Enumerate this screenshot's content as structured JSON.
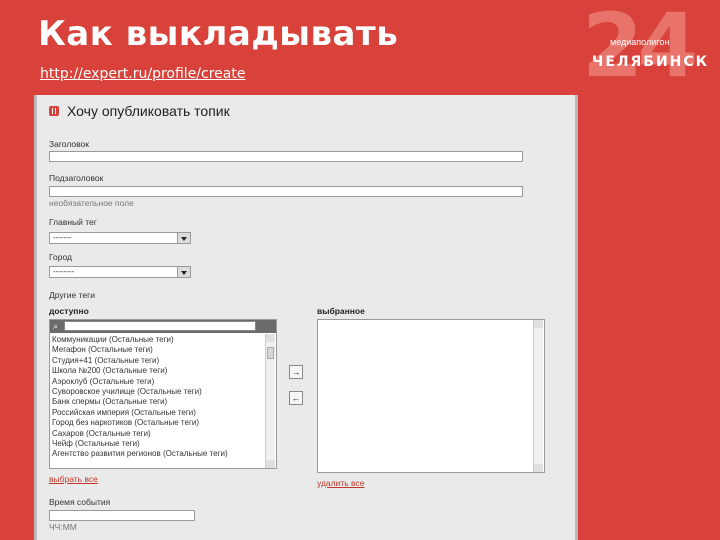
{
  "slide": {
    "title": "Как выкладывать",
    "url": "http://expert.ru/profile/create"
  },
  "logo": {
    "number": "24",
    "subtitle": "медиаполигон",
    "city": "ЧЕЛЯБИНСК"
  },
  "form": {
    "heading": "Хочу опубликовать топик",
    "title_label": "Заголовок",
    "subtitle_label": "Подзаголовок",
    "optional_hint": "необязательное поле",
    "main_tag_label": "Главный тег",
    "main_tag_value": "-------",
    "city_label": "Город",
    "city_value": "--------",
    "other_tags_label": "Другие теги",
    "available_label": "доступно",
    "selected_label": "выбранное",
    "available_items": [
      "Коммуникации (Остальные теги)",
      "Мегафон (Остальные теги)",
      "Студия+41 (Остальные теги)",
      "Школа №200 (Остальные теги)",
      "Аэроклуб (Остальные теги)",
      "Суворовское училище (Остальные теги)",
      "Банк спермы (Остальные теги)",
      "Российская империя (Остальные теги)",
      "Город без наркотиков (Остальные теги)",
      "Сахаров (Остальные теги)",
      "Чейф (Остальные теги)",
      "Агентство развития регионов (Остальные теги)"
    ],
    "add_arrow": "→",
    "remove_arrow": "←",
    "select_all": "выбрать все",
    "remove_all": "удалить все",
    "event_time_label": "Время события",
    "time_format": "ЧЧ:ММ"
  },
  "colors": {
    "slide_background": "#d8423a",
    "accent": "#c0392b"
  }
}
